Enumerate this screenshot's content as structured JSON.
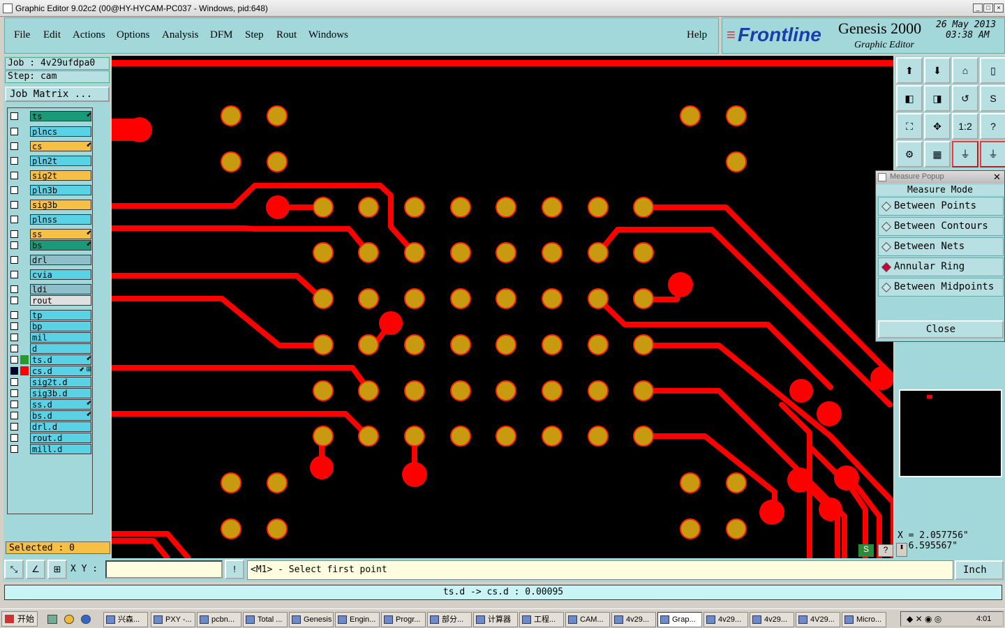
{
  "window": {
    "title": "Graphic Editor 9.02c2 (00@HY-HYCAM-PC037 - Windows, pid:648)"
  },
  "menu": {
    "items": [
      "File",
      "Edit",
      "Actions",
      "Options",
      "Analysis",
      "DFM",
      "Step",
      "Rout",
      "Windows"
    ],
    "help": "Help"
  },
  "brand": {
    "logo": "Frontline",
    "product": "Genesis 2000",
    "subtitle": "Graphic Editor",
    "date": "26 May 2013",
    "time": "03:38 AM"
  },
  "job": {
    "job_line": "Job : 4v29ufdpa0",
    "step_line": "Step: cam",
    "matrix_button": "Job Matrix ..."
  },
  "layers": [
    {
      "name": "ts",
      "color": "#1a9a78",
      "flag": "⬋"
    },
    {
      "name": "plncs",
      "color": "#5ad2e6",
      "flag": ""
    },
    {
      "name": "cs",
      "color": "#f5c043",
      "flag": "⬋"
    },
    {
      "name": "pln2t",
      "color": "#5ad2e6",
      "flag": ""
    },
    {
      "name": "sig2t",
      "color": "#f5c043",
      "flag": ""
    },
    {
      "name": "pln3b",
      "color": "#5ad2e6",
      "flag": ""
    },
    {
      "name": "sig3b",
      "color": "#f5c043",
      "flag": ""
    },
    {
      "name": "plnss",
      "color": "#5ad2e6",
      "flag": ""
    },
    {
      "name": "ss",
      "color": "#f5c043",
      "flag": "⬋"
    },
    {
      "name": "bs",
      "color": "#1a9a78",
      "flag": "⬋"
    },
    {
      "name": "drl",
      "color": "#8fbfc8",
      "flag": ""
    },
    {
      "name": "cvia",
      "color": "#5ad2e6",
      "flag": ""
    },
    {
      "name": "ldi",
      "color": "#8fbfc8",
      "flag": ""
    },
    {
      "name": "rout",
      "color": "#e0e0e0",
      "flag": ""
    },
    {
      "name": "tp",
      "color": "#5ad2e6",
      "flag": ""
    },
    {
      "name": "bp",
      "color": "#5ad2e6",
      "flag": ""
    },
    {
      "name": "mil",
      "color": "#5ad2e6",
      "flag": ""
    },
    {
      "name": "d",
      "color": "#5ad2e6",
      "flag": ""
    },
    {
      "name": "ts.d",
      "color": "#5ad2e6",
      "flag": "⬋"
    },
    {
      "name": "cs.d",
      "color": "#5ad2e6",
      "flag": "⬋ ⊞"
    },
    {
      "name": "sig2t.d",
      "color": "#5ad2e6",
      "flag": ""
    },
    {
      "name": "sig3b.d",
      "color": "#5ad2e6",
      "flag": ""
    },
    {
      "name": "ss.d",
      "color": "#5ad2e6",
      "flag": "⬋"
    },
    {
      "name": "bs.d",
      "color": "#5ad2e6",
      "flag": "⬋"
    },
    {
      "name": "drl.d",
      "color": "#5ad2e6",
      "flag": ""
    },
    {
      "name": "rout.d",
      "color": "#5ad2e6",
      "flag": ""
    },
    {
      "name": "mill.d",
      "color": "#5ad2e6",
      "flag": ""
    }
  ],
  "selected": "Selected : 0",
  "measure_popup": {
    "title": "Measure Popup",
    "heading": "Measure Mode",
    "options": [
      "Between Points",
      "Between Contours",
      "Between Nets",
      "Annular Ring",
      "Between Midpoints"
    ],
    "active_option": "Annular Ring",
    "close": "Close"
  },
  "coords": {
    "x": "X = 2.057756\"",
    "y": "= 6.595567\""
  },
  "command": {
    "xy_label": "X Y :",
    "xy_value": "",
    "prompt": "<M1> - Select first point",
    "unit": "Inch"
  },
  "status": "ts.d -> cs.d : 0.00095",
  "taskbar": {
    "start": "开始",
    "tasks": [
      "兴森...",
      "PXY -...",
      "pcbn...",
      "Total ...",
      "Genesis",
      "Engin...",
      "Progr...",
      "部分...",
      "计算器",
      "工程...",
      "CAM...",
      "4v29...",
      "Grap...",
      "4v29...",
      "4v29...",
      "4V29...",
      "Micro..."
    ],
    "clock": "4:01"
  },
  "colors": {
    "panel": "#a3d8da",
    "trace": "#ff0000",
    "pad": "#c79a10",
    "canvas": "#000000"
  }
}
